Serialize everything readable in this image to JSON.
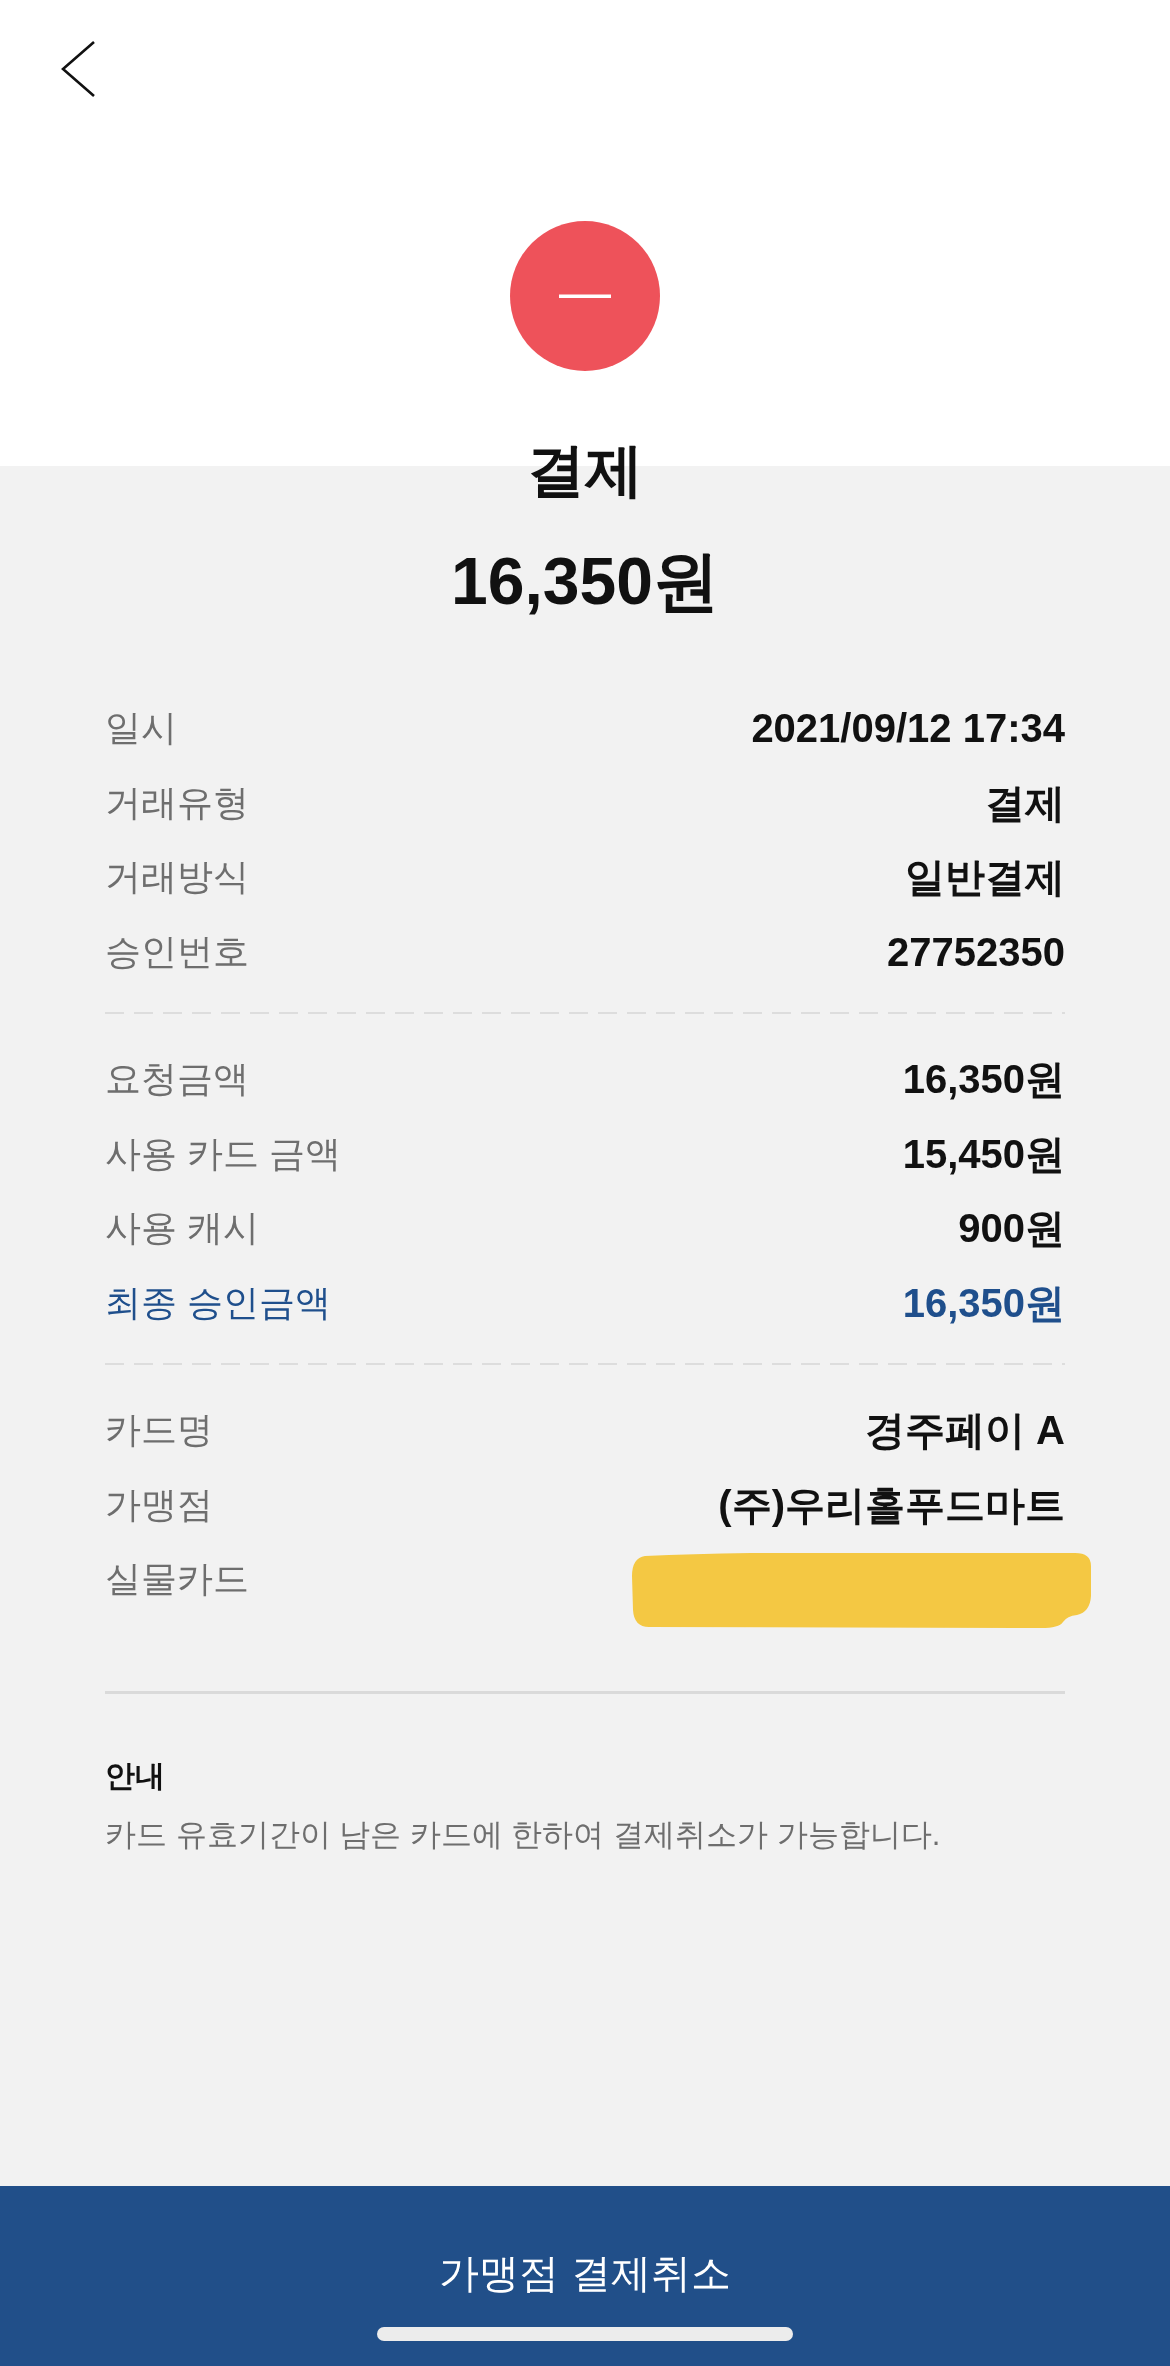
{
  "header": {
    "status_title": "결제",
    "amount": "16,350원"
  },
  "sections": [
    {
      "rows": [
        {
          "kind": "plain",
          "label": "일시",
          "value": "2021/09/12 17:34"
        },
        {
          "kind": "plain",
          "label": "거래유형",
          "value": "결제"
        },
        {
          "kind": "plain",
          "label": "거래방식",
          "value": "일반결제"
        },
        {
          "kind": "plain",
          "label": "승인번호",
          "value": "27752350"
        }
      ]
    },
    {
      "rows": [
        {
          "kind": "plain",
          "label": "요청금액",
          "value": "16,350원"
        },
        {
          "kind": "plain",
          "label": "사용 카드 금액",
          "value": "15,450원"
        },
        {
          "kind": "plain",
          "label": "사용 캐시",
          "value": "900원"
        },
        {
          "kind": "total",
          "label": "최종 승인금액",
          "value": "16,350원"
        }
      ]
    },
    {
      "rows": [
        {
          "kind": "plain",
          "label": "카드명",
          "value": "경주페이 A"
        },
        {
          "kind": "plain",
          "label": "가맹점",
          "value": "(주)우리홀푸드마트"
        },
        {
          "kind": "redacted",
          "label": "실물카드"
        }
      ]
    }
  ],
  "notice": {
    "title": "안내",
    "text": "카드 유효기간이 남은 카드에 한하여 결제취소가 가능합니다."
  },
  "action_button": {
    "label": "가맹점 결제취소"
  }
}
